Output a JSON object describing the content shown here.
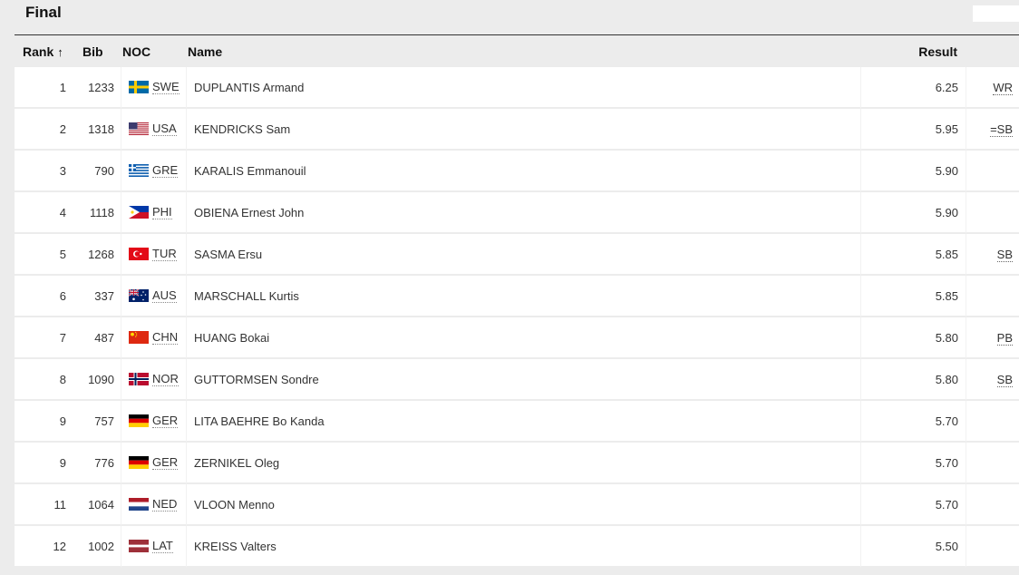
{
  "page": {
    "title": "Final"
  },
  "table": {
    "headers": {
      "rank": "Rank",
      "rank_sort_icon": "↑",
      "bib": "Bib",
      "noc": "NOC",
      "name": "Name",
      "result": "Result"
    },
    "rows": [
      {
        "rank": "1",
        "bib": "1233",
        "noc": "SWE",
        "flag": "swe-flag",
        "name": "DUPLANTIS Armand",
        "result": "6.25",
        "note": "WR"
      },
      {
        "rank": "2",
        "bib": "1318",
        "noc": "USA",
        "flag": "usa-flag",
        "name": "KENDRICKS Sam",
        "result": "5.95",
        "note": "=SB"
      },
      {
        "rank": "3",
        "bib": "790",
        "noc": "GRE",
        "flag": "gre-flag",
        "name": "KARALIS Emmanouil",
        "result": "5.90",
        "note": ""
      },
      {
        "rank": "4",
        "bib": "1118",
        "noc": "PHI",
        "flag": "phi-flag",
        "name": "OBIENA Ernest John",
        "result": "5.90",
        "note": ""
      },
      {
        "rank": "5",
        "bib": "1268",
        "noc": "TUR",
        "flag": "tur-flag",
        "name": "SASMA Ersu",
        "result": "5.85",
        "note": "SB"
      },
      {
        "rank": "6",
        "bib": "337",
        "noc": "AUS",
        "flag": "aus-flag",
        "name": "MARSCHALL Kurtis",
        "result": "5.85",
        "note": ""
      },
      {
        "rank": "7",
        "bib": "487",
        "noc": "CHN",
        "flag": "chn-flag",
        "name": "HUANG Bokai",
        "result": "5.80",
        "note": "PB"
      },
      {
        "rank": "8",
        "bib": "1090",
        "noc": "NOR",
        "flag": "nor-flag",
        "name": "GUTTORMSEN Sondre",
        "result": "5.80",
        "note": "SB"
      },
      {
        "rank": "9",
        "bib": "757",
        "noc": "GER",
        "flag": "ger-flag",
        "name": "LITA BAEHRE Bo Kanda",
        "result": "5.70",
        "note": ""
      },
      {
        "rank": "9",
        "bib": "776",
        "noc": "GER",
        "flag": "ger-flag",
        "name": "ZERNIKEL Oleg",
        "result": "5.70",
        "note": ""
      },
      {
        "rank": "11",
        "bib": "1064",
        "noc": "NED",
        "flag": "ned-flag",
        "name": "VLOON Menno",
        "result": "5.70",
        "note": ""
      },
      {
        "rank": "12",
        "bib": "1002",
        "noc": "LAT",
        "flag": "lat-flag",
        "name": "KREISS Valters",
        "result": "5.50",
        "note": ""
      }
    ]
  }
}
